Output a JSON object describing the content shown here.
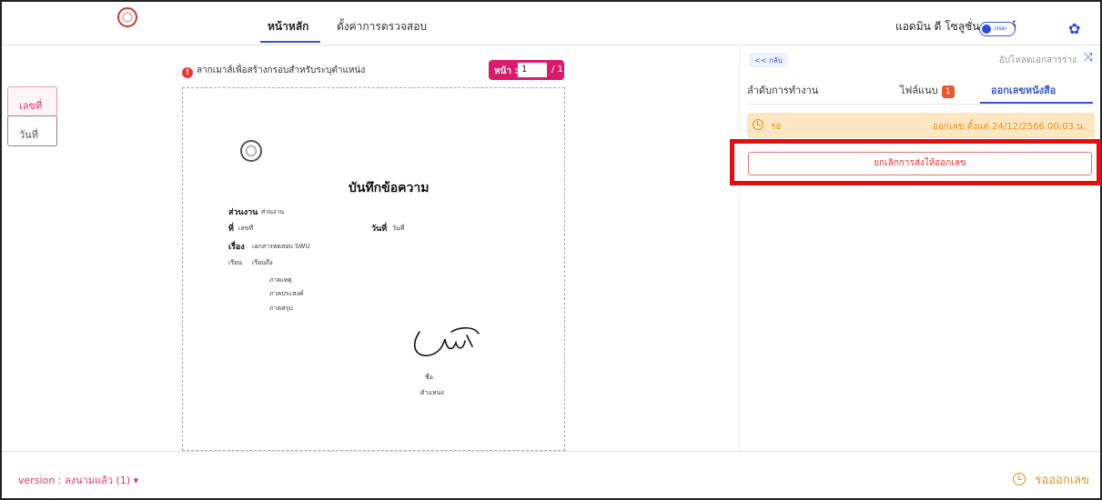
{
  "header": {
    "nav_home": "หน้าหลัก",
    "nav_settings": "ตั้งค่าการตรวจสอบ",
    "user_name": "แอดมิน ดี โซลูชั่น คลาวด์",
    "toggle_label": "User",
    "accent_color": "#2d4bd4"
  },
  "side_tabs": [
    {
      "label": "เลขที่"
    },
    {
      "label": "วันที่"
    }
  ],
  "document": {
    "hint": "ลากเมาส์เพื่อสร้างกรอบสำหรับระบุตำแหน่ง",
    "pager_label": "หน้า :",
    "pager_value": "1",
    "pager_total": "/ 1",
    "memo_title": "บันทึกข้อความ",
    "lines": {
      "dept_label": "ส่วนงาน",
      "dept_value": "ส่วนงาน",
      "no_label": "ที่",
      "no_value": "เลขที่",
      "date_label": "วันที่",
      "date_value": "วันที่",
      "subject_label": "เรื่อง",
      "subject_value": "เอกสารทดสอบ SWU",
      "to_label": "เรียน",
      "to_value": "เรียนถึง",
      "p1": "ภาคเหตุ",
      "p2": "ภาคประสงค์",
      "p3": "ภาคสรุป",
      "sign_name": "ชื่อ",
      "sign_position": "ตำแหน่ง"
    }
  },
  "right_panel": {
    "back": "<< กลับ",
    "upload": "อัปโหลดเอกสารร่าง",
    "tabs": [
      {
        "label": "ลำดับการทำงาน"
      },
      {
        "label": "ไฟล์แนบ",
        "badge": "1"
      },
      {
        "label": "ออกเลขหนังสือ"
      }
    ],
    "status_wait": "รอ",
    "status_detail": "ออกเลข ตั้งแต่ 24/12/2566 00:03 น.",
    "cancel_button": "ยกเลิกการส่งให้ออกเลข",
    "status_color": "#e0921b",
    "highlight_color": "#e01010"
  },
  "footer": {
    "version": "version : ลงนามแล้ว (1) ▾",
    "status": "รอออกเลข"
  }
}
